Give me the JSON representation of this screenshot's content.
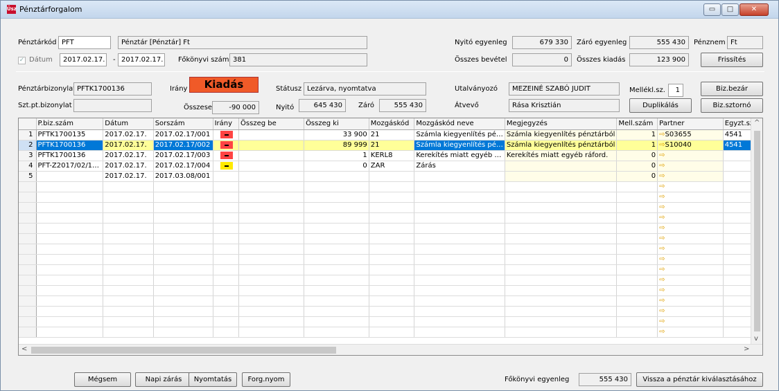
{
  "window": {
    "title": "Pénztárforgalom",
    "app_icon": "Üsz",
    "controls": {
      "minimize": "▭",
      "maximize": "□",
      "close": "✕"
    }
  },
  "header": {
    "penztarkod_label": "Pénztárkód",
    "penztarkod_value": "PFT",
    "penztar_name": "Pénztár [Pénztár] Ft",
    "nyito_label": "Nyitó egyenleg",
    "nyito_value": "679 330",
    "zaro_label": "Záró egyenleg",
    "zaro_value": "555 430",
    "penznem_label": "Pénznem",
    "penznem_value": "Ft",
    "datum_label": "Dátum",
    "datum_checked": "✓",
    "datum_from": "2017.02.17.",
    "datum_dash": "-",
    "datum_to": "2017.02.17.",
    "fokonyvi_label": "Főkönyvi szám",
    "fokonyvi_value": "381",
    "osszes_bevetel_label": "Összes bevétel",
    "osszes_bevetel_value": "0",
    "osszes_kiadas_label": "Összes kiadás",
    "osszes_kiadas_value": "123 900",
    "frissites": "Frissítés"
  },
  "voucher": {
    "bizonylat_label": "Pénztárbizonylat",
    "bizonylat_value": "PFTK1700136",
    "irany_label": "Irány",
    "irany_value": "Kiadás",
    "statusz_label": "Státusz",
    "statusz_value": "Lezárva, nyomtatva",
    "utalvanyozo_label": "Utalványozó",
    "utalvanyozo_value": "MEZEINÉ SZABÓ JUDIT",
    "mellekl_label": "Mellékl.sz.",
    "mellekl_value": "1",
    "biz_bezar": "Biz.bezár",
    "sztpt_label": "Szt.pt.bizonylat",
    "sztpt_value": "",
    "osszesen_label": "Összesen",
    "osszesen_value": "-90 000",
    "nyito_label": "Nyitó",
    "nyito_value": "645 430",
    "zaro_label": "Záró",
    "zaro_value": "555 430",
    "atvevo_label": "Átvevő",
    "atvevo_value": "Rása Krisztián",
    "duplikalas": "Duplikálás",
    "biz_sztorno": "Biz.sztornó"
  },
  "grid": {
    "columns": [
      "P.biz.szám",
      "Dátum",
      "Sorszám",
      "Irány",
      "Összeg be",
      "Összeg ki",
      "Mozgáskód",
      "Mozgáskód neve",
      "Megjegyzés",
      "Mell.szám",
      "Partner",
      "Egyzt.sz"
    ],
    "rows": [
      {
        "n": "1",
        "pbiz": "PFTK1700135",
        "datum": "2017.02.17.",
        "sorszam": "2017.02.17/001",
        "irany": "red",
        "be": "",
        "ki": "33 900",
        "mkod": "21",
        "mnev": "Számla kiegyenlítés pé…",
        "megj": "Számla kiegyenlítés pénztárból",
        "mell": "1",
        "partner": "S03655",
        "egyzt": "4541"
      },
      {
        "n": "2",
        "pbiz": "PFTK1700136",
        "datum": "2017.02.17.",
        "sorszam": "2017.02.17/002",
        "irany": "red",
        "be": "",
        "ki": "89 999",
        "mkod": "21",
        "mnev": "Számla kiegyenlítés pé…",
        "megj": "Számla kiegyenlítés pénztárból",
        "mell": "1",
        "partner": "S10040",
        "egyzt": "4541"
      },
      {
        "n": "3",
        "pbiz": "PFTK1700136",
        "datum": "2017.02.17.",
        "sorszam": "2017.02.17/003",
        "irany": "red",
        "be": "",
        "ki": "1",
        "mkod": "KERL8",
        "mnev": "Kerekítés miatt egyéb …",
        "megj": "Kerekítés miatt egyéb ráford.",
        "mell": "0",
        "partner": "",
        "egyzt": ""
      },
      {
        "n": "4",
        "pbiz": "PFT-Z2017/02/1…",
        "datum": "2017.02.17.",
        "sorszam": "2017.02.17/004",
        "irany": "yel",
        "be": "",
        "ki": "0",
        "mkod": "ZAR",
        "mnev": "Zárás",
        "megj": "",
        "mell": "0",
        "partner": "",
        "egyzt": ""
      },
      {
        "n": "5",
        "pbiz": "",
        "datum": "2017.02.17.",
        "sorszam": "2017.03.08/001",
        "irany": "",
        "be": "",
        "ki": "",
        "mkod": "",
        "mnev": "",
        "megj": "",
        "mell": "0",
        "partner": "",
        "egyzt": ""
      }
    ],
    "selected_row": 2,
    "arrow_icon": "⇨",
    "scroll_up": "^",
    "scroll_down": "v",
    "scroll_left": "<",
    "scroll_right": ">"
  },
  "footer": {
    "megsem": "Mégsem",
    "napi_zaras": "Napi zárás",
    "nyomtatas": "Nyomtatás",
    "forg_nyom": "Forg.nyom",
    "fokonyvi_egyenleg_label": "Főkönyvi egyenleg",
    "fokonyvi_egyenleg_value": "555 430",
    "vissza": "Vissza a pénztár kiválasztásához"
  },
  "colors": {
    "irany_red": "#f44444",
    "irany_yellow": "#ffea00",
    "kiadas_bg": "#f05a28",
    "selected_row": "#ffff99",
    "selected_cell": "#0078d7"
  }
}
